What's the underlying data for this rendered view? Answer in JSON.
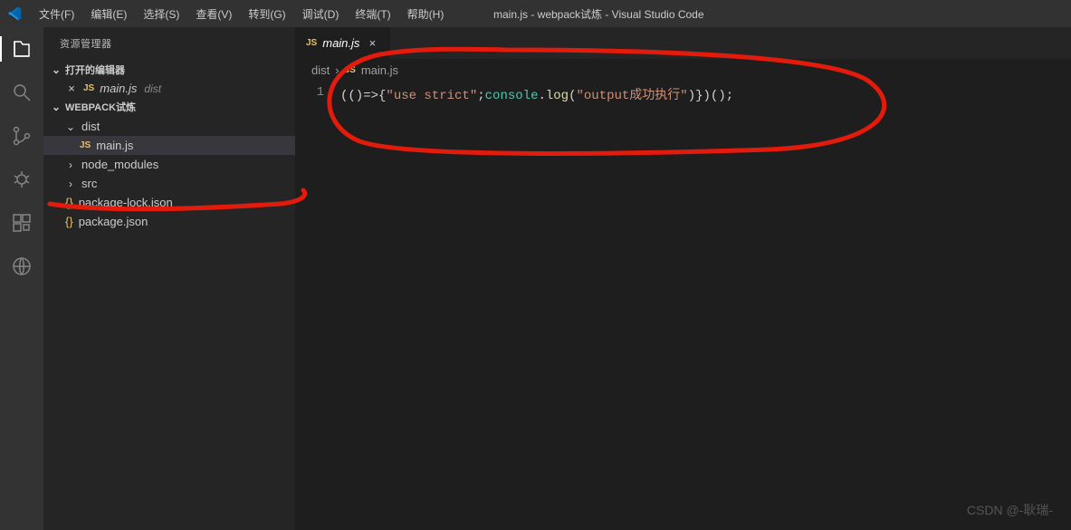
{
  "titlebar": {
    "menu": [
      {
        "label": "文件(F)"
      },
      {
        "label": "编辑(E)"
      },
      {
        "label": "选择(S)"
      },
      {
        "label": "查看(V)"
      },
      {
        "label": "转到(G)"
      },
      {
        "label": "调试(D)"
      },
      {
        "label": "终端(T)"
      },
      {
        "label": "帮助(H)"
      }
    ],
    "title": "main.js - webpack试炼 - Visual Studio Code"
  },
  "sidebar": {
    "title": "资源管理器",
    "sections": {
      "openEditors": {
        "label": "打开的编辑器",
        "items": [
          {
            "icon": "JS",
            "name": "main.js",
            "dir": "dist"
          }
        ]
      },
      "workspace": {
        "label": "WEBPACK试炼",
        "tree": [
          {
            "type": "folder",
            "name": "dist",
            "expanded": true,
            "indent": 1
          },
          {
            "type": "file",
            "icon": "JS",
            "name": "main.js",
            "indent": 2,
            "selected": true
          },
          {
            "type": "folder",
            "name": "node_modules",
            "expanded": false,
            "indent": 1
          },
          {
            "type": "folder",
            "name": "src",
            "expanded": false,
            "indent": 1
          },
          {
            "type": "file",
            "icon": "{}",
            "name": "package-lock.json",
            "indent": 1
          },
          {
            "type": "file",
            "icon": "{}",
            "name": "package.json",
            "indent": 1
          }
        ]
      }
    }
  },
  "editor": {
    "tabs": [
      {
        "icon": "JS",
        "name": "main.js",
        "active": true
      }
    ],
    "breadcrumb": {
      "segments": [
        {
          "label": "dist"
        },
        {
          "icon": "JS",
          "label": "main.js"
        }
      ]
    },
    "code": {
      "lineNumber": "1",
      "tokens": [
        {
          "cls": "tok-punc",
          "text": "(()=>{"
        },
        {
          "cls": "tok-str",
          "text": "\"use strict\""
        },
        {
          "cls": "tok-punc",
          "text": ";"
        },
        {
          "cls": "tok-keyword",
          "text": "console"
        },
        {
          "cls": "tok-punc",
          "text": "."
        },
        {
          "cls": "tok-method",
          "text": "log"
        },
        {
          "cls": "tok-punc",
          "text": "("
        },
        {
          "cls": "tok-str",
          "text": "\"output成功执行\""
        },
        {
          "cls": "tok-punc",
          "text": ")})();"
        }
      ]
    }
  },
  "watermark": "CSDN @-耿瑞-"
}
